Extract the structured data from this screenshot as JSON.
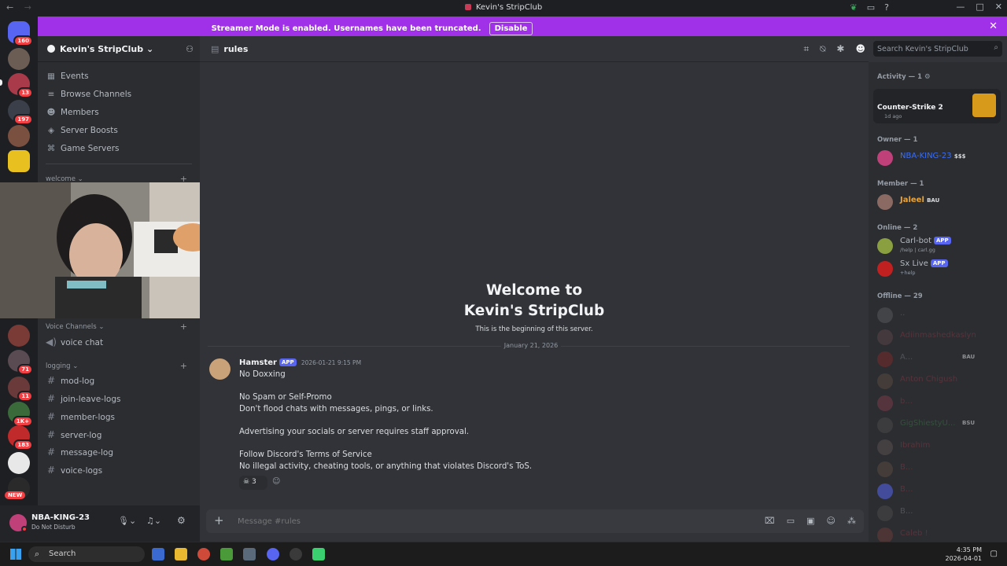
{
  "window": {
    "title": "Kevin's StripClub",
    "back": "←",
    "forward": "→"
  },
  "banner": {
    "text": "Streamer Mode is enabled. Usernames have been truncated.",
    "button": "Disable",
    "close": "✕"
  },
  "guilds": {
    "home_badge": "160",
    "badges": [
      "13",
      "197",
      "71",
      "11",
      "1K+",
      "183",
      "NEW"
    ]
  },
  "server": {
    "name": "Kevin's StripClub",
    "chevron": "⌄"
  },
  "nav": [
    {
      "label": "Events",
      "icon": "calendar-icon"
    },
    {
      "label": "Browse Channels",
      "icon": "browse-icon"
    },
    {
      "label": "Members",
      "icon": "members-icon"
    },
    {
      "label": "Server Boosts",
      "icon": "boost-icon"
    },
    {
      "label": "Game Servers",
      "icon": "gamepad-icon"
    }
  ],
  "categories": {
    "welcome": "welcome",
    "voice": "Voice Channels",
    "logging": "logging"
  },
  "voice_channels": [
    "voice chat"
  ],
  "logging_channels": [
    "mod-log",
    "join-leave-logs",
    "member-logs",
    "server-log",
    "message-log",
    "voice-logs"
  ],
  "user": {
    "name": "NBA-KING-23",
    "status": "Do Not Disturb"
  },
  "channel": {
    "name": "rules"
  },
  "search": {
    "placeholder": "Search Kevin's StripClub"
  },
  "welcome": {
    "title_line1": "Welcome to",
    "title_line2": "Kevin's StripClub",
    "subtitle": "This is the beginning of this server."
  },
  "date_divider": "January 21, 2026",
  "message": {
    "author": "Hamster",
    "tag": "APP",
    "timestamp": "2026-01-21 9:15 PM",
    "lines": [
      "No Doxxing",
      "",
      "No Spam or Self-Promo",
      "Don't flood chats with messages, pings, or links.",
      "",
      "Advertising your socials or server requires staff approval.",
      "",
      "Follow Discord's Terms of Service",
      "No illegal activity, cheating tools, or anything that violates Discord's ToS."
    ],
    "reaction_count": "3"
  },
  "composer": {
    "placeholder": "Message #rules"
  },
  "members": {
    "activity_header": "Activity — 1",
    "activity": {
      "game": "Counter-Strike 2",
      "time": "1d ago"
    },
    "owner_header": "Owner — 1",
    "owner": {
      "name": "NBA-KING-23",
      "tag": "$$$"
    },
    "member_header": "Member — 1",
    "member": {
      "name": "Jaleel",
      "tag": "BAU"
    },
    "online_header": "Online — 2",
    "online": [
      {
        "name": "Carl-bot",
        "tag": "APP",
        "sub": "/help | carl.gg"
      },
      {
        "name": "Sx Live",
        "tag": "APP",
        "sub": "+help"
      }
    ],
    "offline_header": "Offline — 29",
    "offline": [
      {
        "name": "..",
        "color": "#6d6f78"
      },
      {
        "name": "Adiinmashedkaslyn",
        "color": "#7a3a44"
      },
      {
        "name": "A...",
        "color": "#6d6f78",
        "tag": "BAU"
      },
      {
        "name": "Anton Chigush",
        "color": "#7a3a44"
      },
      {
        "name": "b...",
        "color": "#7a3a44"
      },
      {
        "name": "GigShiestyU...",
        "color": "#3f6b48",
        "tag": "BSU"
      },
      {
        "name": "Ibrahim",
        "color": "#7a3a44"
      },
      {
        "name": "B...",
        "color": "#7a3a44"
      },
      {
        "name": "B...",
        "color": "#7a3a44"
      },
      {
        "name": "B...",
        "color": "#6d6f78"
      },
      {
        "name": "Caleb !",
        "color": "#7a3a44"
      }
    ]
  },
  "taskbar": {
    "search": "Search",
    "time": "4:35 PM",
    "date": "2026-04-01"
  },
  "colors": {
    "banner": "#a131e9",
    "blurple": "#5865f2",
    "owner_name": "#3b6ef5",
    "member_name": "#e8a33a"
  }
}
